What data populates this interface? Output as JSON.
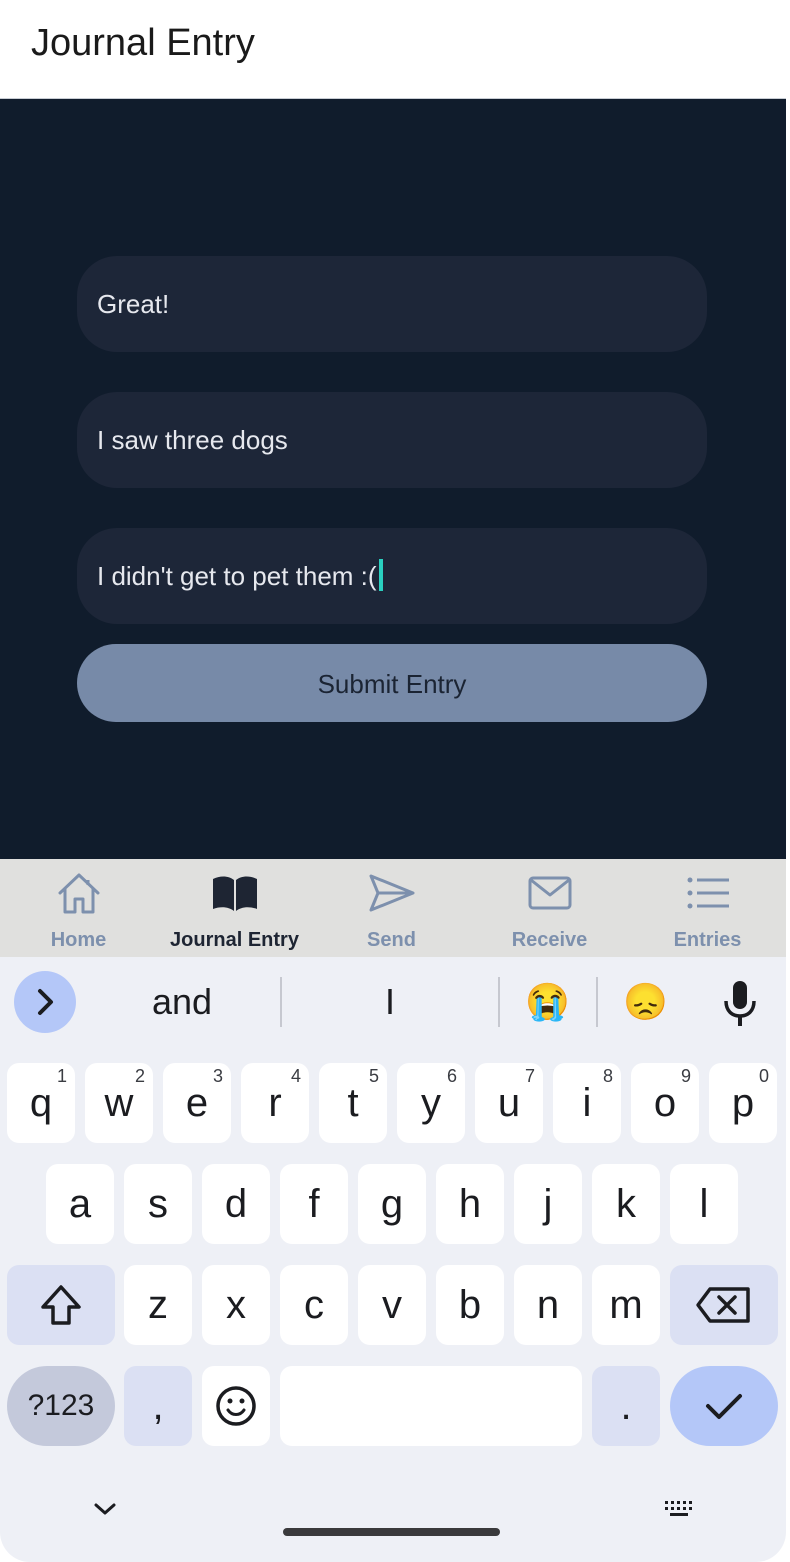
{
  "app": {
    "title": "Journal Entry"
  },
  "form": {
    "field1": "Great!",
    "field2": "I saw three dogs",
    "field3": "I didn't get to pet them :(",
    "submit_label": "Submit Entry"
  },
  "tabs": [
    {
      "label": "Home",
      "icon": "home-icon",
      "active": false
    },
    {
      "label": "Journal Entry",
      "icon": "book-icon",
      "active": true
    },
    {
      "label": "Send",
      "icon": "send-icon",
      "active": false
    },
    {
      "label": "Receive",
      "icon": "mail-icon",
      "active": false
    },
    {
      "label": "Entries",
      "icon": "list-icon",
      "active": false
    }
  ],
  "keyboard": {
    "suggestions": [
      "and",
      "I"
    ],
    "emoji_suggestions": [
      "😭",
      "😞"
    ],
    "row1": [
      {
        "k": "q",
        "s": "1"
      },
      {
        "k": "w",
        "s": "2"
      },
      {
        "k": "e",
        "s": "3"
      },
      {
        "k": "r",
        "s": "4"
      },
      {
        "k": "t",
        "s": "5"
      },
      {
        "k": "y",
        "s": "6"
      },
      {
        "k": "u",
        "s": "7"
      },
      {
        "k": "i",
        "s": "8"
      },
      {
        "k": "o",
        "s": "9"
      },
      {
        "k": "p",
        "s": "0"
      }
    ],
    "row2": [
      "a",
      "s",
      "d",
      "f",
      "g",
      "h",
      "j",
      "k",
      "l"
    ],
    "row3": [
      "z",
      "x",
      "c",
      "v",
      "b",
      "n",
      "m"
    ],
    "symbols_label": "?123",
    "comma": ",",
    "period": "."
  },
  "colors": {
    "background": "#101c2c",
    "field": "#1d2638",
    "button": "#778aa8",
    "caret": "#2ad0c0",
    "tab_inactive": "#7d90ad",
    "tab_active": "#1e2533"
  }
}
